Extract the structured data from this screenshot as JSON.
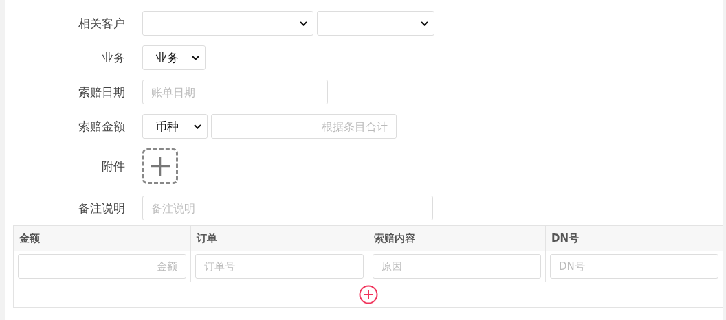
{
  "form": {
    "rows": [
      {
        "kind": "select-pair",
        "label": "相关客户"
      },
      {
        "kind": "select",
        "label": "业务",
        "selects": [
          {
            "value": "业务"
          }
        ]
      },
      {
        "kind": "input",
        "label": "索赔日期",
        "placeholder": "账单日期"
      },
      {
        "kind": "select-input",
        "label": "索赔金额",
        "selects": [
          {
            "value": "币种"
          }
        ],
        "placeholder": "根据条目合计"
      },
      {
        "kind": "upload",
        "label": "附件"
      },
      {
        "kind": "wide-input",
        "label": "备注说明",
        "placeholder": "备注说明"
      }
    ]
  },
  "table": {
    "columns": [
      "金额",
      "订单",
      "索赔内容",
      "DN号"
    ],
    "rows": [
      {
        "placeholders": [
          "金额",
          "订单号",
          "原因",
          "DN号"
        ]
      }
    ]
  }
}
